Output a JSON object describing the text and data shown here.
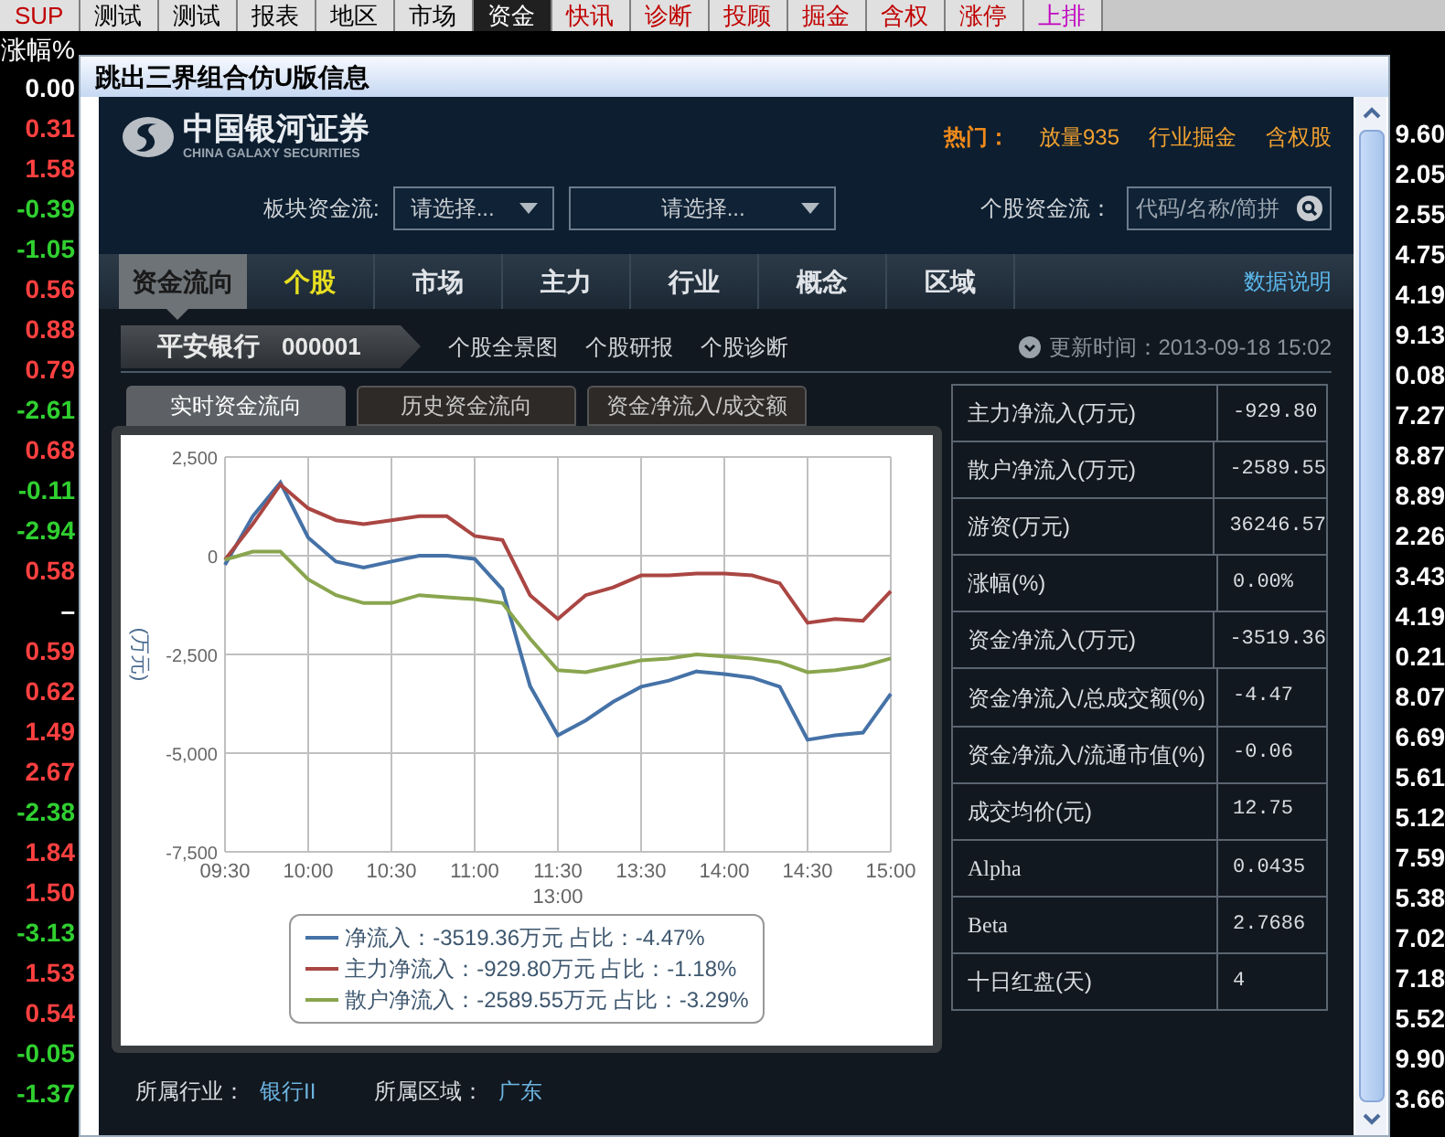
{
  "top_tabs": [
    {
      "label": "SUP",
      "selected": false,
      "color": "#c00000"
    },
    {
      "label": "测试",
      "selected": false,
      "color": "#000000"
    },
    {
      "label": "测试",
      "selected": false,
      "color": "#000000"
    },
    {
      "label": "报表",
      "selected": false,
      "color": "#000000"
    },
    {
      "label": "地区",
      "selected": false,
      "color": "#000000"
    },
    {
      "label": "市场",
      "selected": false,
      "color": "#000000"
    },
    {
      "label": "资金",
      "selected": true,
      "color": "#ffffff"
    },
    {
      "label": "快讯",
      "selected": false,
      "color": "#c00000"
    },
    {
      "label": "诊断",
      "selected": false,
      "color": "#c00000"
    },
    {
      "label": "投顾",
      "selected": false,
      "color": "#c00000"
    },
    {
      "label": "掘金",
      "selected": false,
      "color": "#c00000"
    },
    {
      "label": "含权",
      "selected": false,
      "color": "#c00000"
    },
    {
      "label": "涨停",
      "selected": false,
      "color": "#c00000"
    },
    {
      "label": "上排",
      "selected": false,
      "color": "#c000c0"
    }
  ],
  "left_column": {
    "header": "涨幅%",
    "rows": [
      {
        "value": "0.00",
        "color": "#ffffff"
      },
      {
        "value": "0.31",
        "color": "#ff4040"
      },
      {
        "value": "1.58",
        "color": "#ff4040"
      },
      {
        "value": "-0.39",
        "color": "#30d030"
      },
      {
        "value": "-1.05",
        "color": "#30d030"
      },
      {
        "value": "0.56",
        "color": "#ff4040"
      },
      {
        "value": "0.88",
        "color": "#ff4040"
      },
      {
        "value": "0.79",
        "color": "#ff4040"
      },
      {
        "value": "-2.61",
        "color": "#30d030"
      },
      {
        "value": "0.68",
        "color": "#ff4040"
      },
      {
        "value": "-0.11",
        "color": "#30d030"
      },
      {
        "value": "-2.94",
        "color": "#30d030"
      },
      {
        "value": "0.58",
        "color": "#ff4040"
      },
      {
        "value": "–",
        "color": "#ffffff"
      },
      {
        "value": "0.59",
        "color": "#ff4040"
      },
      {
        "value": "0.62",
        "color": "#ff4040"
      },
      {
        "value": "1.49",
        "color": "#ff4040"
      },
      {
        "value": "2.67",
        "color": "#ff4040"
      },
      {
        "value": "-2.38",
        "color": "#30d030"
      },
      {
        "value": "1.84",
        "color": "#ff4040"
      },
      {
        "value": "1.50",
        "color": "#ff4040"
      },
      {
        "value": "-3.13",
        "color": "#30d030"
      },
      {
        "value": "1.53",
        "color": "#ff4040"
      },
      {
        "value": "0.54",
        "color": "#ff4040"
      },
      {
        "value": "-0.05",
        "color": "#30d030"
      },
      {
        "value": "-1.37",
        "color": "#30d030"
      }
    ]
  },
  "right_column": [
    "9.60",
    "2.05",
    "2.55",
    "4.75",
    "4.19",
    "9.13",
    "0.08",
    "7.27",
    "8.87",
    "8.89",
    "2.26",
    "3.43",
    "4.19",
    "0.21",
    "8.07",
    "6.69",
    "5.61",
    "5.12",
    "7.59",
    "5.38",
    "7.02",
    "7.18",
    "5.52",
    "9.90",
    "3.66"
  ],
  "dialog": {
    "title": "跳出三界组合仿U版信息"
  },
  "brand": {
    "name": "中国银河证券",
    "tagline": "CHINA GALAXY SECURITIES"
  },
  "hot": {
    "label": "热门：",
    "links": [
      "放量935",
      "行业掘金",
      "含权股"
    ]
  },
  "filters": {
    "sector_label": "板块资金流:",
    "selects": [
      "请选择...",
      "请选择..."
    ],
    "stock_label": "个股资金流：",
    "search_placeholder": "代码/名称/简拼"
  },
  "nav": {
    "title": "资金流向",
    "items": [
      {
        "label": "个股",
        "selected": true
      },
      {
        "label": "市场",
        "selected": false
      },
      {
        "label": "主力",
        "selected": false
      },
      {
        "label": "行业",
        "selected": false
      },
      {
        "label": "概念",
        "selected": false
      },
      {
        "label": "区域",
        "selected": false
      }
    ],
    "help_link": "数据说明"
  },
  "stock": {
    "name": "平安银行",
    "code": "000001",
    "links": [
      "个股全景图",
      "个股研报",
      "个股诊断"
    ],
    "update_time": "更新时间：2013-09-18 15:02"
  },
  "chart_tabs": [
    {
      "label": "实时资金流向",
      "selected": true
    },
    {
      "label": "历史资金流向",
      "selected": false
    },
    {
      "label": "资金净流入/成交额",
      "selected": false
    }
  ],
  "chart_data": {
    "type": "line",
    "ylabel": "(万元)",
    "categories": [
      "09:30",
      null,
      null,
      "10:00",
      null,
      null,
      "10:30",
      null,
      null,
      "11:00",
      null,
      null,
      "11:30",
      null,
      null,
      "13:30",
      null,
      null,
      "14:00",
      null,
      null,
      "14:30",
      null,
      null,
      "15:00"
    ],
    "annotations": [
      "13:00"
    ],
    "grid": true,
    "legend": true,
    "yticks": [
      {
        "value": 2500,
        "label": "2,500"
      },
      {
        "value": 0,
        "label": "0"
      },
      {
        "value": -2500,
        "label": "-2,500"
      },
      {
        "value": -5000,
        "label": "-5,000"
      },
      {
        "value": -7500,
        "label": "-7,500"
      }
    ],
    "ylim": [
      -7500,
      2500
    ],
    "series": [
      {
        "name": "净流入：-3519.36万元 占比：-4.47%",
        "color": "#4572a7",
        "values": [
          -230,
          1000,
          1850,
          460,
          -150,
          -300,
          -150,
          0,
          0,
          -80,
          -850,
          -3300,
          -4550,
          -4170,
          -3700,
          -3320,
          -3160,
          -2930,
          -3000,
          -3090,
          -3320,
          -4660,
          -4550,
          -4480,
          -3500
        ]
      },
      {
        "name": "主力净流入：-929.80万元 占比：-1.18%",
        "color": "#aa4643",
        "values": [
          -100,
          800,
          1800,
          1200,
          900,
          800,
          900,
          1000,
          1000,
          500,
          400,
          -1000,
          -1600,
          -1000,
          -800,
          -500,
          -500,
          -450,
          -450,
          -500,
          -700,
          -1700,
          -1600,
          -1650,
          -900
        ]
      },
      {
        "name": "散户净流入：-2589.55万元 占比：-3.29%",
        "color": "#89a54e",
        "values": [
          -100,
          100,
          100,
          -600,
          -1000,
          -1200,
          -1200,
          -1000,
          -1050,
          -1100,
          -1200,
          -2100,
          -2900,
          -2950,
          -2800,
          -2650,
          -2600,
          -2500,
          -2550,
          -2600,
          -2700,
          -2950,
          -2900,
          -2800,
          -2600
        ]
      }
    ]
  },
  "stats": [
    {
      "label": "主力净流入(万元)",
      "value": "-929.80"
    },
    {
      "label": "散户净流入(万元)",
      "value": "-2589.55"
    },
    {
      "label": "游资(万元)",
      "value": "36246.57"
    },
    {
      "label": "涨幅(%)",
      "value": "0.00%"
    },
    {
      "label": "资金净流入(万元)",
      "value": "-3519.36"
    },
    {
      "label": "资金净流入/总成交额(%)",
      "value": "-4.47"
    },
    {
      "label": "资金净流入/流通市值(%)",
      "value": "-0.06"
    },
    {
      "label": "成交均价(元)",
      "value": "12.75"
    },
    {
      "label": "Alpha",
      "value": "0.0435"
    },
    {
      "label": "Beta",
      "value": "2.7686"
    },
    {
      "label": "十日红盘(天)",
      "value": "4"
    }
  ],
  "footer": {
    "industry_label": "所属行业：",
    "industry": "银行II",
    "region_label": "所属区域：",
    "region": "广东"
  }
}
